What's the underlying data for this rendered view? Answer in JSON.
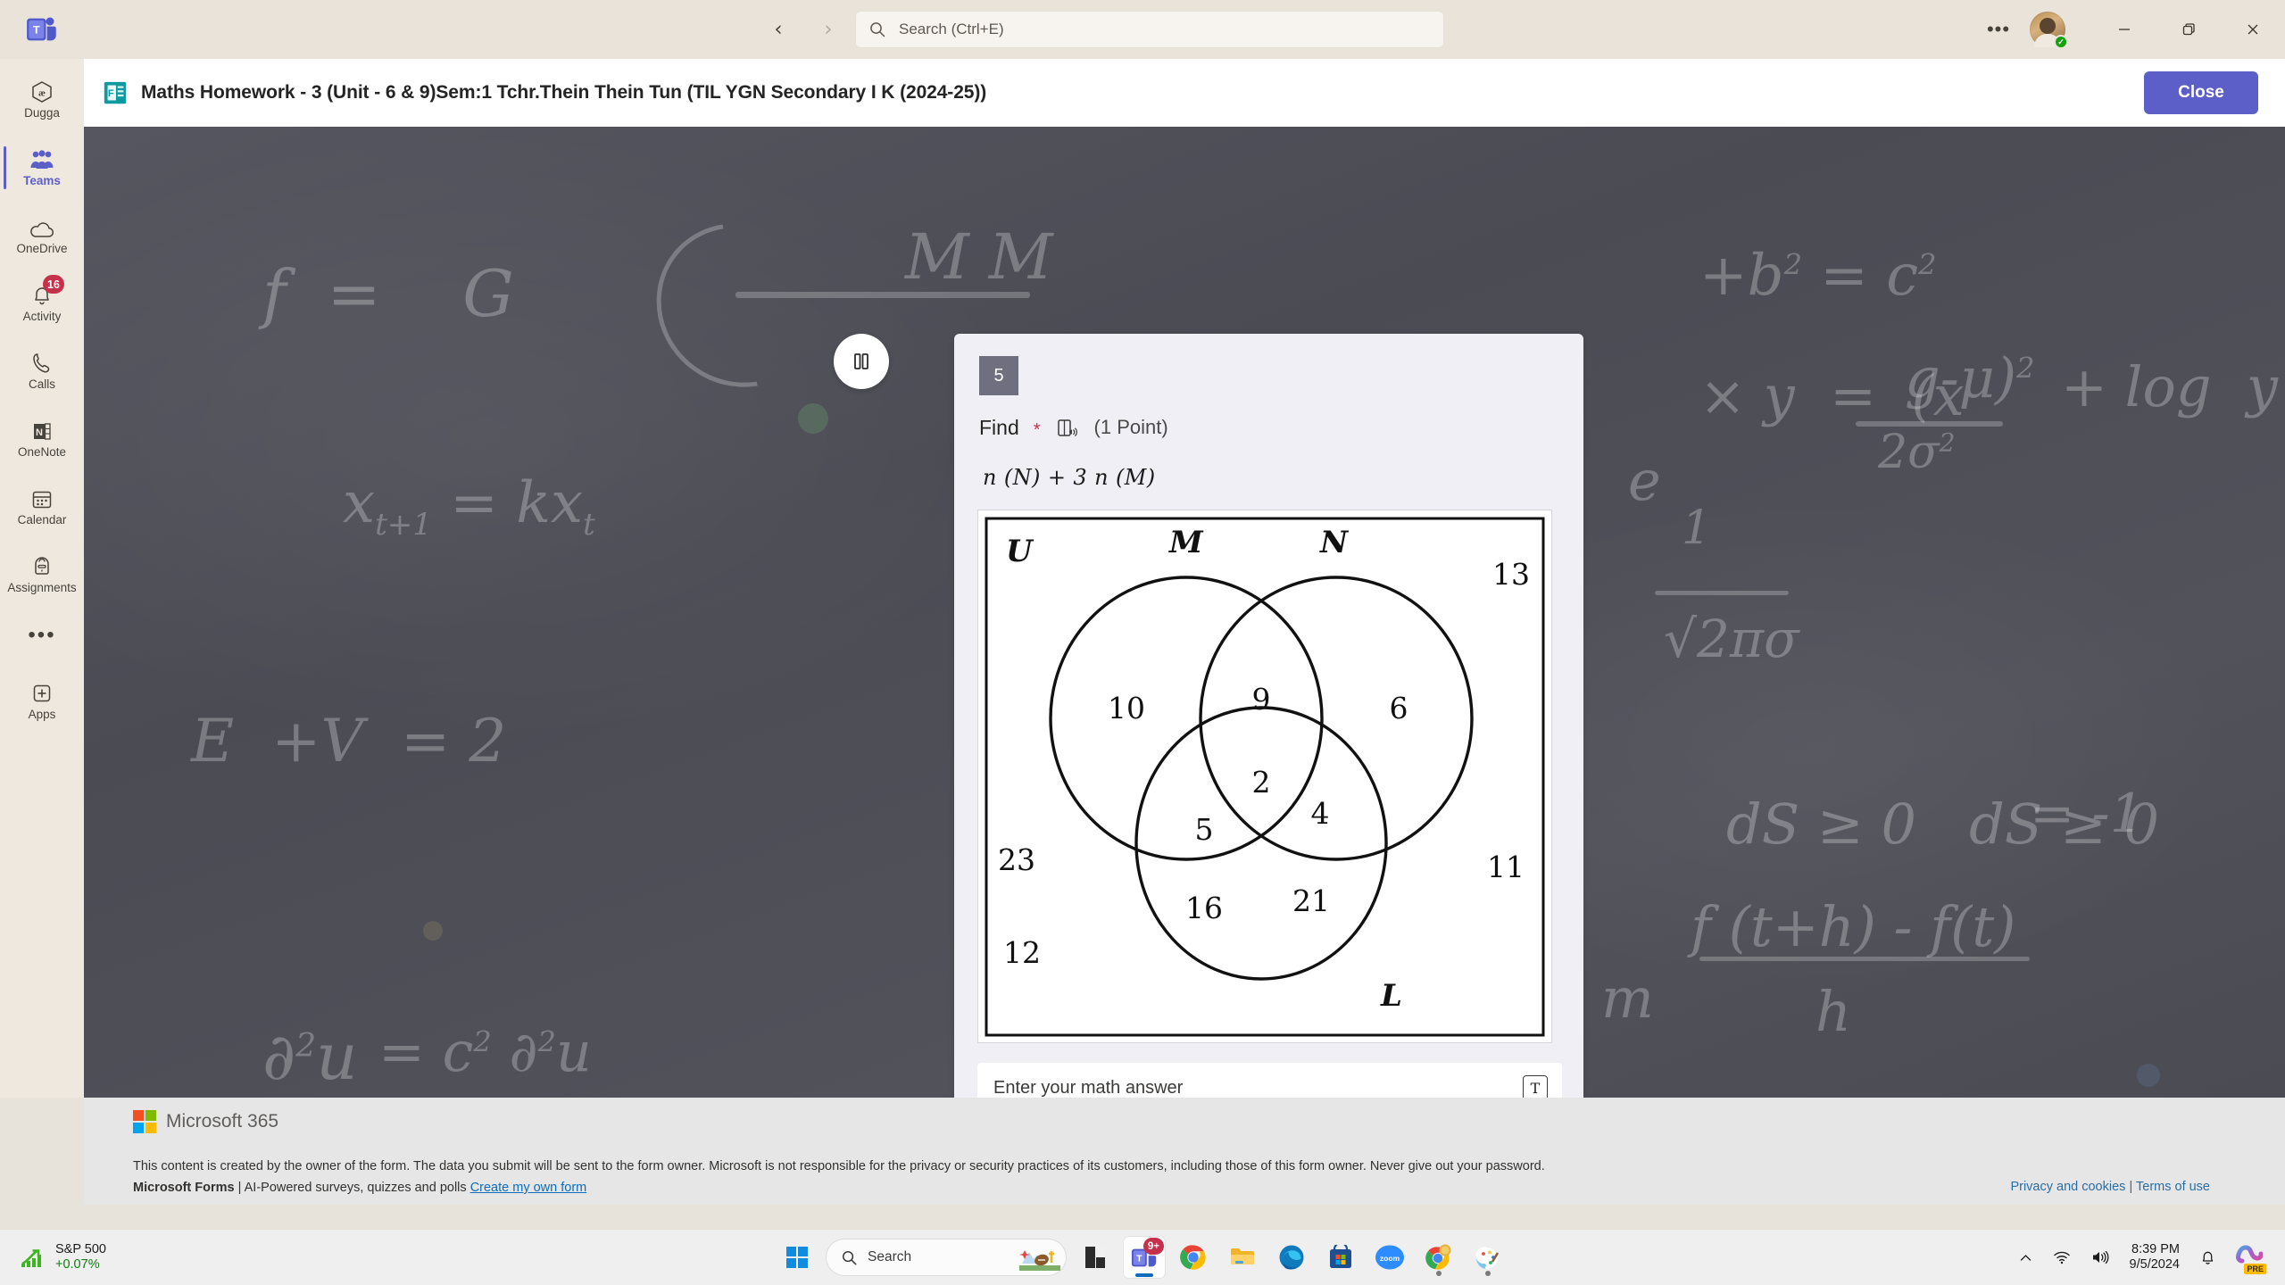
{
  "titlebar": {
    "back_label": "‹",
    "forward_label": "›",
    "search": {
      "placeholder": "Search (Ctrl+E)",
      "value": ""
    },
    "more_label": "•••",
    "minimize_label": "—",
    "restore_label": "❐",
    "close_label": "✕",
    "presence_status": "available"
  },
  "rail": {
    "items": [
      {
        "label": "Dugga",
        "icon": "dugga-icon",
        "active": false,
        "badge": ""
      },
      {
        "label": "Teams",
        "icon": "teams-icon",
        "active": true,
        "badge": ""
      },
      {
        "label": "OneDrive",
        "icon": "onedrive-icon",
        "active": false,
        "badge": ""
      },
      {
        "label": "Activity",
        "icon": "activity-bell-icon",
        "active": false,
        "badge": "16"
      },
      {
        "label": "Calls",
        "icon": "calls-phone-icon",
        "active": false,
        "badge": ""
      },
      {
        "label": "OneNote",
        "icon": "onenote-icon",
        "active": false,
        "badge": ""
      },
      {
        "label": "Calendar",
        "icon": "calendar-icon",
        "active": false,
        "badge": ""
      },
      {
        "label": "Assignments",
        "icon": "backpack-icon",
        "active": false,
        "badge": ""
      },
      {
        "label": "Apps",
        "icon": "apps-plus-icon",
        "active": false,
        "badge": ""
      }
    ],
    "more_label": "•••"
  },
  "form": {
    "title": "Maths Homework - 3 (Unit - 6 & 9)Sem:1 Tchr.Thein Thein Tun (TIL YGN Secondary I K (2024-25))",
    "close_label": "Close",
    "pause_label": "pause"
  },
  "question": {
    "number": "5",
    "prompt": "Find",
    "required_marker": "*",
    "points": "(1 Point)",
    "math_expression": "n (N)  + 3 n (M)",
    "answer_placeholder": "Enter your math answer",
    "answer_value": ""
  },
  "chart_data": {
    "type": "diagram",
    "title": "Three-set Venn diagram",
    "universe_label": "U",
    "sets": [
      "M",
      "N",
      "L"
    ],
    "regions": [
      {
        "label": "M only",
        "value": 10
      },
      {
        "label": "M ∩ N only",
        "value": 9
      },
      {
        "label": "N only",
        "value": 6
      },
      {
        "label": "M ∩ N ∩ L",
        "value": 2
      },
      {
        "label": "M ∩ L only",
        "value": 5
      },
      {
        "label": "N ∩ L only",
        "value": 4
      },
      {
        "label": "L only left",
        "value": 16
      },
      {
        "label": "L only right",
        "value": 21
      },
      {
        "label": "outside top-left",
        "value": 23
      },
      {
        "label": "outside top-right",
        "value": 13
      },
      {
        "label": "outside bot-right",
        "value": 11
      },
      {
        "label": "outside bot-left",
        "value": 12
      }
    ]
  },
  "footer": {
    "brand": "Microsoft 365",
    "disclaimer": "This content is created by the owner of the form. The data you submit will be sent to the form owner. Microsoft is not responsible for the privacy or security practices of its customers, including those of this form owner. Never give out your password.",
    "forms_brand": "Microsoft Forms",
    "forms_tagline": "| AI-Powered surveys, quizzes and polls",
    "create_link": "Create my own form",
    "privacy_link": "Privacy and cookies",
    "separator": "|",
    "terms_link": "Terms of use"
  },
  "taskbar": {
    "stock_name": "S&P 500",
    "stock_change": "+0.07%",
    "search_placeholder": "Search",
    "apps": [
      {
        "name": "start-button",
        "badge": ""
      },
      {
        "name": "widgets-weather",
        "badge": ""
      },
      {
        "name": "file-explorer-dark",
        "badge": ""
      },
      {
        "name": "microsoft-teams",
        "badge": "9+"
      },
      {
        "name": "google-chrome",
        "badge": ""
      },
      {
        "name": "file-explorer",
        "badge": ""
      },
      {
        "name": "microsoft-edge",
        "badge": ""
      },
      {
        "name": "microsoft-store",
        "badge": ""
      },
      {
        "name": "zoom",
        "badge": ""
      },
      {
        "name": "chrome-secondary",
        "badge": ""
      },
      {
        "name": "paint",
        "badge": ""
      }
    ],
    "zoom_label": "zoom",
    "time": "8:39 PM",
    "date": "9/5/2024",
    "copilot_badge": "PRE"
  },
  "colors": {
    "accent": "#5b5fc7",
    "rail_bg": "#eee8df",
    "badge_red": "#c4314b",
    "link_blue": "#0f6cbd",
    "green": "#107c10"
  }
}
